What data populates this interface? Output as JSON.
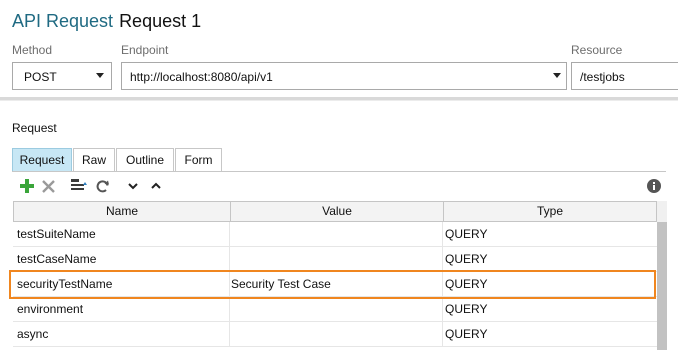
{
  "header": {
    "app_title": "API Request",
    "request_name": "Request 1"
  },
  "method": {
    "label": "Method",
    "value": "POST"
  },
  "endpoint": {
    "label": "Endpoint",
    "value": "http://localhost:8080/api/v1"
  },
  "resource": {
    "label": "Resource",
    "value": "/testjobs"
  },
  "request_section": {
    "label": "Request",
    "tabs": [
      "Request",
      "Raw",
      "Outline",
      "Form"
    ],
    "active_tab": "Request"
  },
  "toolbar": {
    "icons": [
      "add-icon",
      "delete-icon",
      "encode-icon",
      "refresh-icon",
      "move-down-icon",
      "move-up-icon",
      "info-icon"
    ],
    "colors": {
      "add": "#3aa53a",
      "delete": "#9a9a9a",
      "info": "#555555"
    }
  },
  "table": {
    "headers": {
      "name": "Name",
      "value": "Value",
      "type": "Type"
    },
    "rows": [
      {
        "name": "testSuiteName",
        "value": "",
        "type": "QUERY"
      },
      {
        "name": "testCaseName",
        "value": "",
        "type": "QUERY"
      },
      {
        "name": "securityTestName",
        "value": "Security Test Case",
        "type": "QUERY",
        "highlighted": true
      },
      {
        "name": "environment",
        "value": "",
        "type": "QUERY"
      },
      {
        "name": "async",
        "value": "",
        "type": "QUERY"
      }
    ]
  },
  "colors": {
    "accent_title": "#1f6a82",
    "active_tab": "#c7e7f5",
    "highlight_border": "#f0861f"
  }
}
